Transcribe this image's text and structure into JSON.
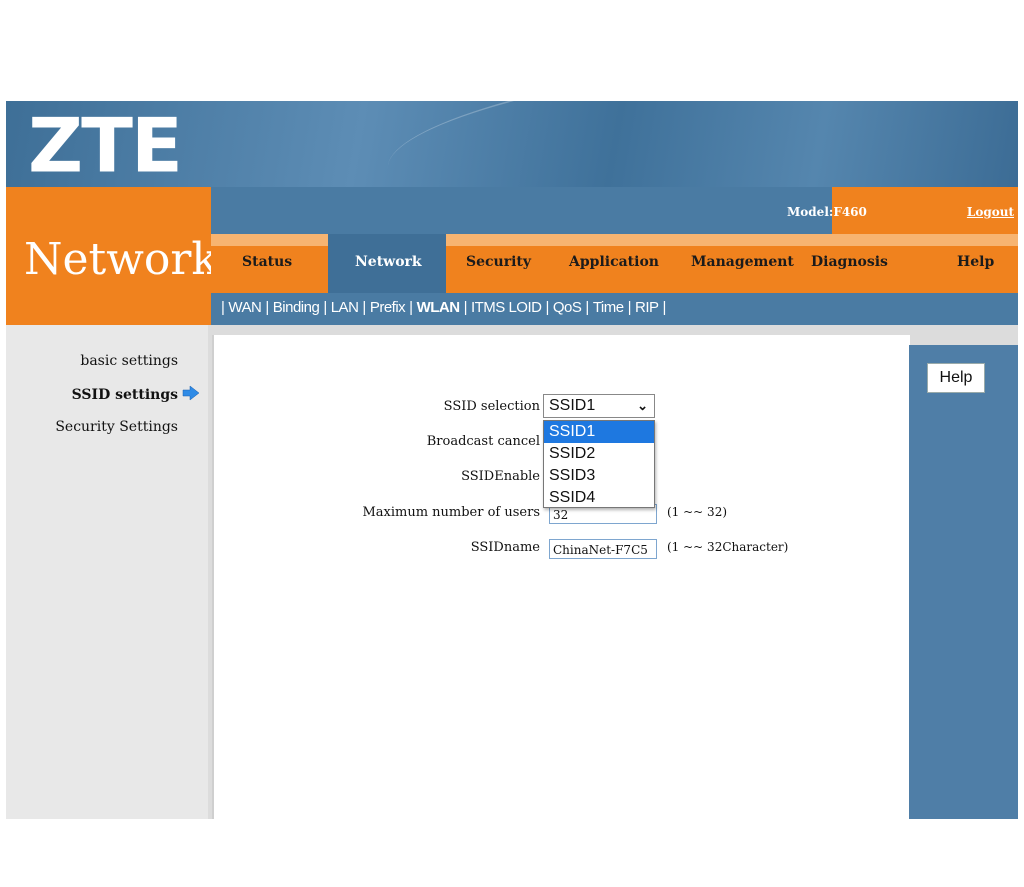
{
  "header": {
    "logo": "ZTE",
    "section_title": "Network",
    "model_label": "Model:",
    "model_value": "F460",
    "logout": "Logout"
  },
  "nav": [
    {
      "label": "Status"
    },
    {
      "label": "Network"
    },
    {
      "label": "Security"
    },
    {
      "label": "Application"
    },
    {
      "label": "Management"
    },
    {
      "label": "Diagnosis"
    },
    {
      "label": "Help"
    }
  ],
  "subnav": [
    "WAN",
    "Binding",
    "LAN",
    "Prefix",
    "WLAN",
    "ITMS LOID",
    "QoS",
    "Time",
    "RIP"
  ],
  "sidebar": [
    "basic settings",
    "SSID settings",
    "Security Settings"
  ],
  "form": {
    "ssid_selection_label": "SSID selection",
    "ssid_selected": "SSID1",
    "ssid_options": [
      "SSID1",
      "SSID2",
      "SSID3",
      "SSID4"
    ],
    "broadcast_label": "Broadcast cancel",
    "enable_label": "SSIDEnable",
    "max_users_label": "Maximum number of users",
    "max_users_value": "32",
    "max_users_hint": "(1 ~~ 32)",
    "ssid_name_label": "SSIDname",
    "ssid_name_value": "ChinaNet-F7C5",
    "ssid_name_hint": "(1 ~~ 32Character)"
  },
  "help_button": "Help",
  "colors": {
    "orange": "#f0821e",
    "blue": "#4a7ba3",
    "select_highlight": "#1e78e0"
  }
}
